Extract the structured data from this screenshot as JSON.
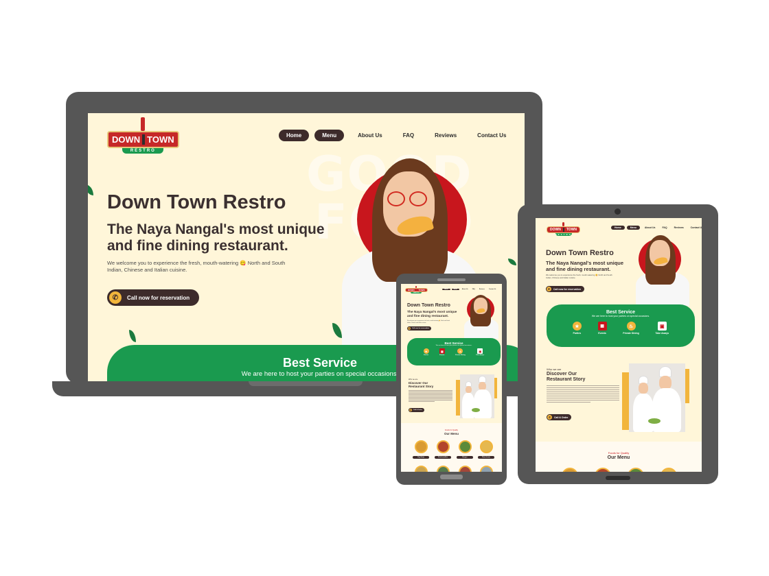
{
  "site": {
    "logo": {
      "top": "DOWN",
      "top2": "TOWN",
      "sub": "RESTRO"
    },
    "nav": [
      "Home",
      "Menu",
      "About Us",
      "FAQ",
      "Reviews",
      "Contact Us"
    ],
    "ghost_words": [
      "GOOD",
      "FOOD"
    ],
    "hero": {
      "title": "Down Town  Restro",
      "subtitle_line1": "The Naya Nangal's most unique",
      "subtitle_line2": "and fine dining restaurant.",
      "desc_line1": "We welcome you to experience the fresh, mouth-watering 😋 North and South",
      "desc_line2": "Indian, Chinese and Italian cuisine.",
      "cta": "Call now for reservation"
    },
    "service": {
      "title": "Best Service",
      "subtitle": "We are here to host your parties on special occasions.",
      "items": [
        "Parties",
        "Events",
        "Private Dining",
        "Take Aways"
      ]
    },
    "story": {
      "kicker": "Who we are",
      "title_line1": "Discover Our",
      "title_line2": "Restaurant Story",
      "cta": "Call & Order"
    },
    "menu": {
      "kicker": "Foods for Quality",
      "title": "Our Menu",
      "items": [
        "Veg Soup",
        "Fried noodles",
        "Burger",
        "Pizza Lover"
      ]
    }
  },
  "colors": {
    "cream": "#fff6d9",
    "green": "#1a9a4f",
    "dark": "#3d2b2b",
    "red": "#c8161d",
    "yellow": "#f2b53c",
    "device_frame": "#565656"
  },
  "icons": {
    "phone_cta": "phone-icon",
    "parties": "party-icon",
    "events": "events-icon",
    "private_dining": "dining-icon",
    "take_aways": "takeaway-icon"
  }
}
